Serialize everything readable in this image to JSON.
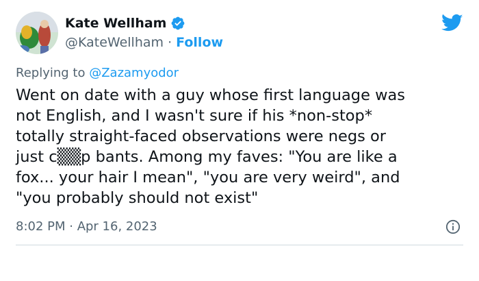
{
  "author": {
    "display_name": "Kate Wellham",
    "handle": "@KateWellham",
    "separator": " · ",
    "follow_label": "Follow"
  },
  "reply": {
    "prefix": "Replying to ",
    "mention": "@Zazamyodor"
  },
  "tweet": {
    "text": "Went on date with a guy whose first language was\nnot English, and I wasn't sure if his *non-stop*\ntotally straight-faced observations were negs or\njust c▒▒p bants. Among my faves: \"You are like a\nfox... your hair I mean\", \"you are very weird\", and\n\"you probably should not exist\"",
    "timestamp": "8:02 PM · Apr 16, 2023"
  },
  "colors": {
    "accent": "#1d9bf0",
    "secondary_text": "#536471",
    "primary_text": "#0f1419"
  },
  "icons": {
    "verified": "verified-badge-icon",
    "brand": "twitter-bird-icon",
    "info": "info-icon"
  }
}
